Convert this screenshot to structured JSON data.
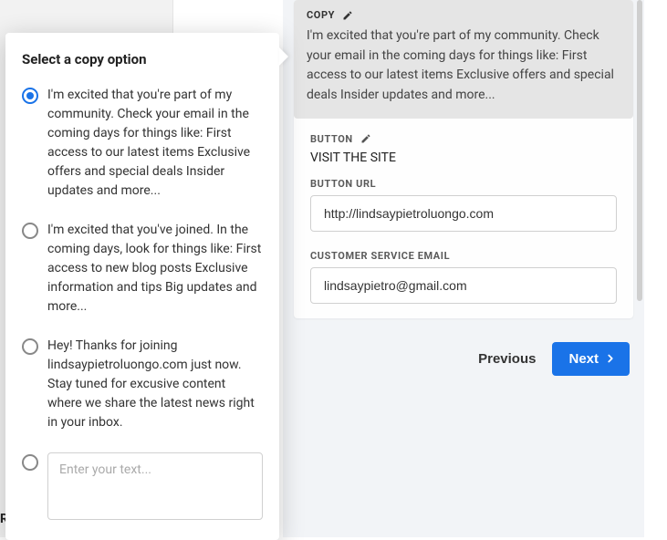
{
  "popover": {
    "title": "Select a copy option",
    "options": [
      "I'm excited that you're part of my community. Check your email in the coming days for things like: First access to our latest items Exclusive offers and special deals Insider updates and more...",
      "I'm excited that you've joined. In the coming days, look for things like: First access to new blog posts Exclusive information and tips Big updates and more...",
      "Hey! Thanks for joining lindsaypietroluongo.com just now. Stay tuned for excusive content where we share the latest news right in your inbox."
    ],
    "custom_placeholder": "Enter your text..."
  },
  "editor": {
    "copy_label": "COPY",
    "copy_text": "I'm excited that you're part of my community. Check your email in the coming days for things like: First access to our latest items Exclusive offers and special deals Insider updates and more...",
    "button_label": "BUTTON",
    "button_text": "VISIT THE SITE",
    "button_url_label": "BUTTON URL",
    "button_url_value": "http://lindsaypietroluongo.com",
    "cs_email_label": "CUSTOMER SERVICE EMAIL",
    "cs_email_value": "lindsaypietro@gmail.com"
  },
  "nav": {
    "previous": "Previous",
    "next": "Next"
  },
  "left_hint": "RM"
}
